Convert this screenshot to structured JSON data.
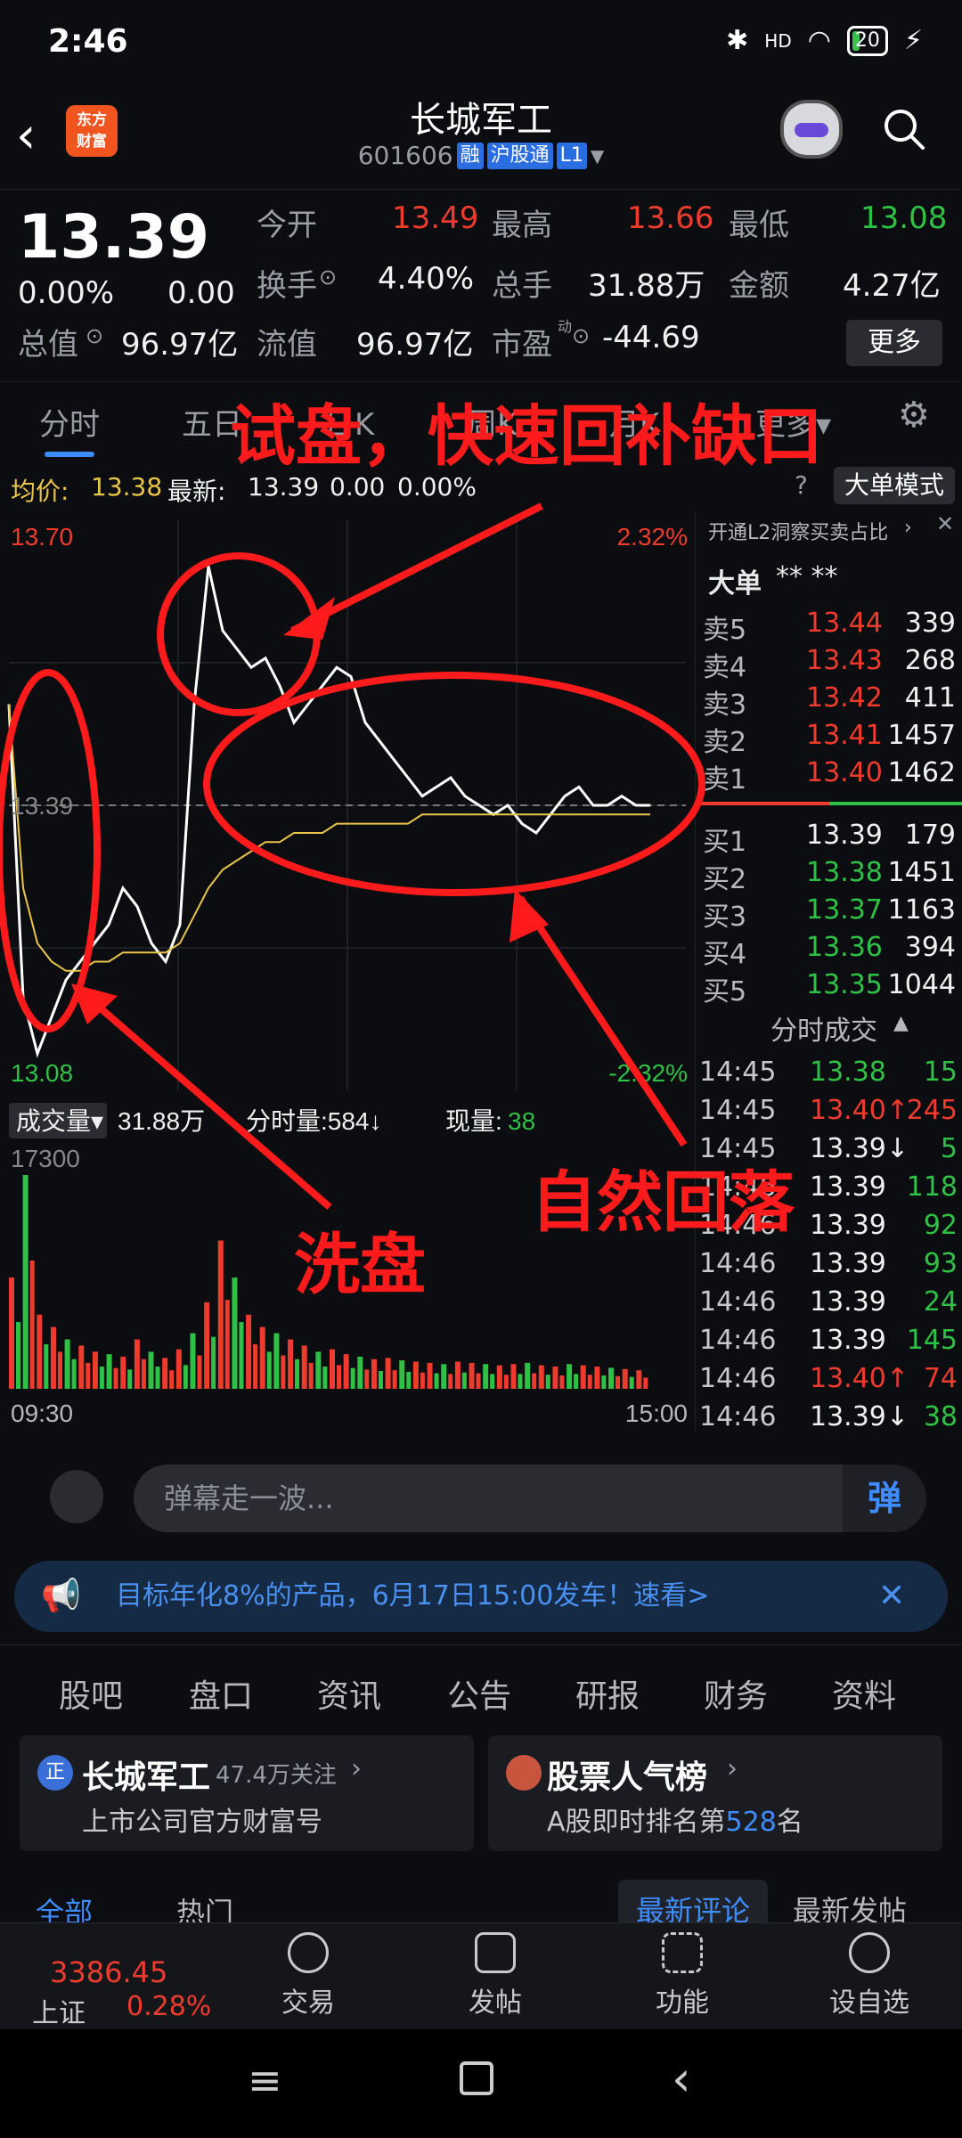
{
  "status_bar": {
    "time": "2:46",
    "battery": "20",
    "network": "HD"
  },
  "header": {
    "back_icon": "back-arrow-icon",
    "app_logo": "东方\n财富",
    "stock_name": "长城军工",
    "stock_code": "601606",
    "tags": [
      "融",
      "沪股通",
      "L1"
    ],
    "search_icon": "search-icon"
  },
  "quote": {
    "price": "13.39",
    "change_pct": "0.00%",
    "change": "0.00",
    "open_label": "今开",
    "open": "13.49",
    "high_label": "最高",
    "high": "13.66",
    "low_label": "最低",
    "low": "13.08",
    "turnover_label": "换手",
    "turnover": "4.40%",
    "volume_label": "总手",
    "volume": "31.88万",
    "amount_label": "金额",
    "amount": "4.27亿",
    "mktcap_label": "总值",
    "mktcap": "96.97亿",
    "float_label": "流值",
    "float_cap": "96.97亿",
    "pe_label": "市盈",
    "pe_sup": "动",
    "pe": "-44.69",
    "more_label": "更多"
  },
  "tabs": [
    "分时",
    "五日",
    "日K",
    "周K",
    "月K",
    "更多"
  ],
  "avg_row": {
    "avg_label": "均价:",
    "avg": "13.38",
    "latest_label": "最新:",
    "latest": "13.39",
    "chg": "0.00",
    "chg_pct": "0.00%",
    "big_order_mode": "大单模式"
  },
  "chart_data": {
    "type": "line",
    "title": "",
    "y_max_label": "13.70",
    "y_min_label": "13.08",
    "y_mid_label": "13.39",
    "pct_max_label": "2.32%",
    "pct_min_label": "-2.32%",
    "ylim": [
      13.08,
      13.7
    ],
    "x_start": "09:30",
    "x_end": "15:00",
    "series": [
      {
        "name": "最新",
        "values": [
          13.5,
          13.18,
          13.12,
          13.16,
          13.2,
          13.22,
          13.24,
          13.26,
          13.3,
          13.28,
          13.24,
          13.22,
          13.26,
          13.5,
          13.65,
          13.58,
          13.56,
          13.54,
          13.55,
          13.52,
          13.48,
          13.5,
          13.52,
          13.54,
          13.53,
          13.48,
          13.46,
          13.44,
          13.42,
          13.4,
          13.41,
          13.42,
          13.4,
          13.39,
          13.38,
          13.39,
          13.37,
          13.36,
          13.38,
          13.4,
          13.41,
          13.39,
          13.39,
          13.4,
          13.39,
          13.39
        ]
      },
      {
        "name": "均价",
        "values": [
          13.5,
          13.3,
          13.24,
          13.22,
          13.21,
          13.21,
          13.22,
          13.22,
          13.23,
          13.23,
          13.23,
          13.23,
          13.24,
          13.27,
          13.3,
          13.32,
          13.33,
          13.34,
          13.35,
          13.35,
          13.36,
          13.36,
          13.36,
          13.37,
          13.37,
          13.37,
          13.37,
          13.37,
          13.37,
          13.38,
          13.38,
          13.38,
          13.38,
          13.38,
          13.38,
          13.38,
          13.38,
          13.38,
          13.38,
          13.38,
          13.38,
          13.38,
          13.38,
          13.38,
          13.38,
          13.38
        ]
      }
    ],
    "volume": {
      "label": "成交量",
      "total": "31.88万",
      "interval_label": "分时量:",
      "interval": "584",
      "current_label": "现量:",
      "current": "38",
      "max_label": "17300",
      "values": [
        9000,
        17300,
        6000,
        5000,
        4000,
        3500,
        3000,
        2800,
        2600,
        4000,
        3000,
        2500,
        3200,
        4500,
        7000,
        12000,
        9000,
        6000,
        5000,
        4500,
        4000,
        3500,
        3000,
        3200,
        2800,
        2600,
        2400,
        2500,
        2300,
        2200,
        2100,
        2000,
        2200,
        2100,
        2000,
        1900,
        2000,
        2100,
        1900,
        1800,
        2000,
        1900,
        1800,
        1700,
        1600,
        1500
      ]
    }
  },
  "order_book": {
    "promo": "开通L2洞察买卖占比",
    "big_label": "大单",
    "big_value": "**   **",
    "sells": [
      {
        "label": "卖5",
        "price": "13.44",
        "vol": "339"
      },
      {
        "label": "卖4",
        "price": "13.43",
        "vol": "268"
      },
      {
        "label": "卖3",
        "price": "13.42",
        "vol": "411"
      },
      {
        "label": "卖2",
        "price": "13.41",
        "vol": "1457"
      },
      {
        "label": "卖1",
        "price": "13.40",
        "vol": "1462"
      }
    ],
    "buys": [
      {
        "label": "买1",
        "price": "13.39",
        "vol": "179"
      },
      {
        "label": "买2",
        "price": "13.38",
        "vol": "1451"
      },
      {
        "label": "买3",
        "price": "13.37",
        "vol": "1163"
      },
      {
        "label": "买4",
        "price": "13.36",
        "vol": "394"
      },
      {
        "label": "买5",
        "price": "13.35",
        "vol": "1044"
      }
    ],
    "ticks_title": "分时成交",
    "ticks": [
      {
        "time": "14:45",
        "price": "13.38",
        "vol": "15",
        "pc": "green",
        "vc": "green"
      },
      {
        "time": "14:45",
        "price": "13.40↑",
        "vol": "245",
        "pc": "red",
        "vc": "red"
      },
      {
        "time": "14:45",
        "price": "13.39↓",
        "vol": "5",
        "pc": "white",
        "vc": "green"
      },
      {
        "time": "14:46",
        "price": "13.39",
        "vol": "118",
        "pc": "white",
        "vc": "green"
      },
      {
        "time": "14:46",
        "price": "13.39",
        "vol": "92",
        "pc": "white",
        "vc": "green"
      },
      {
        "time": "14:46",
        "price": "13.39",
        "vol": "93",
        "pc": "white",
        "vc": "green"
      },
      {
        "time": "14:46",
        "price": "13.39",
        "vol": "24",
        "pc": "white",
        "vc": "green"
      },
      {
        "time": "14:46",
        "price": "13.39",
        "vol": "145",
        "pc": "white",
        "vc": "green"
      },
      {
        "time": "14:46",
        "price": "13.40↑",
        "vol": "74",
        "pc": "red",
        "vc": "red"
      },
      {
        "time": "14:46",
        "price": "13.39↓",
        "vol": "38",
        "pc": "white",
        "vc": "green"
      }
    ]
  },
  "annotations": {
    "top": "试盘，快速回补缺口",
    "wash": "洗盘",
    "fall": "自然回落"
  },
  "comment": {
    "placeholder": "弹幕走一波...",
    "send": "弹"
  },
  "ad": {
    "text": "目标年化8%的产品，6月17日15:00发车！速看>"
  },
  "guba_tabs": [
    "股吧",
    "盘口",
    "资讯",
    "公告",
    "研报",
    "财务",
    "资料"
  ],
  "cards": [
    {
      "title": "长城军工",
      "extra": "47.4万关注",
      "sub": "上市公司官方财富号"
    },
    {
      "title": "股票人气榜",
      "sub_prefix": "A股即时排名第",
      "rank": "528",
      "sub_suffix": "名"
    }
  ],
  "sub_tabs": {
    "all": "全部",
    "hot": "热门",
    "latest_comment": "最新评论",
    "latest_post": "最新发帖"
  },
  "bottom_bar": {
    "index_value": "3386.45",
    "index_name": "上证",
    "index_pct": "0.28%",
    "items": [
      "交易",
      "发帖",
      "功能",
      "设自选"
    ]
  },
  "colors": {
    "up": "#ef3b2e",
    "down": "#2fc146",
    "accent": "#3f8cff",
    "annotation": "#ff1b1b",
    "price_line": "#ffffff",
    "avg_line": "#e9c64a"
  }
}
